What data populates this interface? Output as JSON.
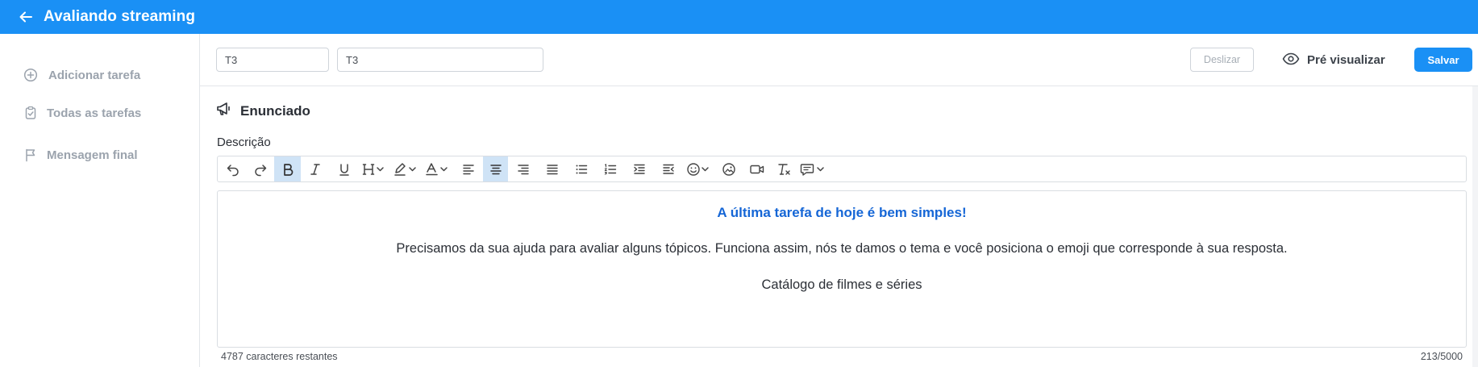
{
  "header": {
    "title": "Avaliando streaming",
    "back_icon": "arrow-left-icon"
  },
  "sidebar": {
    "items": [
      {
        "label": "Adicionar tarefa",
        "icon": "plus-circle-icon"
      },
      {
        "label": "Todas as tarefas",
        "icon": "clipboard-check-icon"
      },
      {
        "label": "Mensagem final",
        "icon": "flag-icon"
      }
    ]
  },
  "task_bar": {
    "input_short": {
      "value": "T3"
    },
    "input_long": {
      "value": "T3"
    },
    "deslizar_label": "Deslizar",
    "preview_label": "Pré visualizar",
    "save_label": "Salvar"
  },
  "section": {
    "title": "Enunciado",
    "icon": "megaphone-icon",
    "description_label": "Descrição"
  },
  "toolbar": {
    "buttons": [
      "undo",
      "redo",
      "bold",
      "italic",
      "underline",
      "heading",
      "highlight",
      "font-color",
      "align-left",
      "align-center",
      "align-right",
      "align-justify",
      "bullet-list",
      "numbered-list",
      "indent",
      "outdent",
      "emoji",
      "image",
      "video",
      "clear-format",
      "comment"
    ],
    "active": [
      "bold",
      "align-center"
    ]
  },
  "editor": {
    "heading": "A última tarefa de hoje é bem simples!",
    "paragraph": "Precisamos da sua ajuda para avaliar alguns tópicos. Funciona assim, nós te damos o tema e você posiciona o emoji que corresponde à sua resposta.",
    "topic": "Catálogo de filmes e séries"
  },
  "footer": {
    "remaining": "4787 caracteres restantes",
    "count": "213/5000"
  },
  "colors": {
    "primary": "#1a90f5",
    "heading_text": "#1566d6",
    "active_tool": "#cfe3f6"
  }
}
